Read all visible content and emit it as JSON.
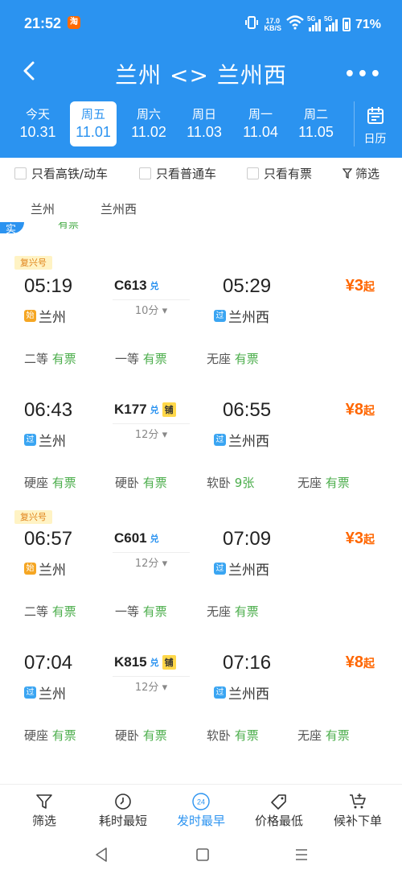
{
  "status_bar": {
    "time": "21:52",
    "app_badge": "淘",
    "speed_top": "17.0",
    "speed_bottom": "KB/S",
    "sig1": "5G",
    "sig2": "5G",
    "battery": "71%"
  },
  "header": {
    "title": "兰州 <> 兰州西"
  },
  "dates": [
    {
      "weekday": "今天",
      "date": "10.31"
    },
    {
      "weekday": "周五",
      "date": "11.01",
      "selected": true
    },
    {
      "weekday": "周六",
      "date": "11.02"
    },
    {
      "weekday": "周日",
      "date": "11.03"
    },
    {
      "weekday": "周一",
      "date": "11.04"
    },
    {
      "weekday": "周二",
      "date": "11.05"
    }
  ],
  "calendar_label": "日历",
  "filters": {
    "high_speed": "只看高铁/动车",
    "normal": "只看普通车",
    "available": "只看有票",
    "filter": "筛选"
  },
  "stations": {
    "from": "兰州",
    "to": "兰州西"
  },
  "peek_badge": "实",
  "peek_text": "有票",
  "fuxing_label": "复兴号",
  "dui_label": "兑",
  "pu_label": "铺",
  "start_tag": "始",
  "pass_tag": "过",
  "price_suffix": "起",
  "trains": [
    {
      "fuxing": true,
      "dep": "05:19",
      "no": "C613",
      "pu": false,
      "arr": "05:29",
      "dur": "10分",
      "from_tag": "start",
      "from": "兰州",
      "to": "兰州西",
      "price": "¥3",
      "seats": [
        {
          "n": "二等",
          "v": "有票"
        },
        {
          "n": "一等",
          "v": "有票"
        },
        {
          "n": "无座",
          "v": "有票"
        }
      ]
    },
    {
      "fuxing": false,
      "dep": "06:43",
      "no": "K177",
      "pu": true,
      "arr": "06:55",
      "dur": "12分",
      "from_tag": "pass",
      "from": "兰州",
      "to": "兰州西",
      "price": "¥8",
      "seats": [
        {
          "n": "硬座",
          "v": "有票"
        },
        {
          "n": "硬卧",
          "v": "有票"
        },
        {
          "n": "软卧",
          "v": "9张"
        },
        {
          "n": "无座",
          "v": "有票"
        }
      ]
    },
    {
      "fuxing": true,
      "dep": "06:57",
      "no": "C601",
      "pu": false,
      "arr": "07:09",
      "dur": "12分",
      "from_tag": "start",
      "from": "兰州",
      "to": "兰州西",
      "price": "¥3",
      "seats": [
        {
          "n": "二等",
          "v": "有票"
        },
        {
          "n": "一等",
          "v": "有票"
        },
        {
          "n": "无座",
          "v": "有票"
        }
      ]
    },
    {
      "fuxing": false,
      "dep": "07:04",
      "no": "K815",
      "pu": true,
      "arr": "07:16",
      "dur": "12分",
      "from_tag": "pass",
      "from": "兰州",
      "to": "兰州西",
      "price": "¥8",
      "seats": [
        {
          "n": "硬座",
          "v": "有票"
        },
        {
          "n": "硬卧",
          "v": "有票"
        },
        {
          "n": "软卧",
          "v": "有票"
        },
        {
          "n": "无座",
          "v": "有票"
        }
      ]
    }
  ],
  "bottom_tabs": [
    {
      "label": "筛选",
      "icon": "funnel-icon"
    },
    {
      "label": "耗时最短",
      "icon": "clock-icon"
    },
    {
      "label": "发时最早",
      "icon": "early-icon",
      "active": true,
      "badge": "24"
    },
    {
      "label": "价格最低",
      "icon": "price-tag-icon"
    },
    {
      "label": "候补下单",
      "icon": "cart-icon"
    }
  ],
  "colors": {
    "brand": "#2b93f0",
    "price": "#ff6600",
    "available": "#4cae4c",
    "fuxing_bg": "#fff3c4"
  }
}
